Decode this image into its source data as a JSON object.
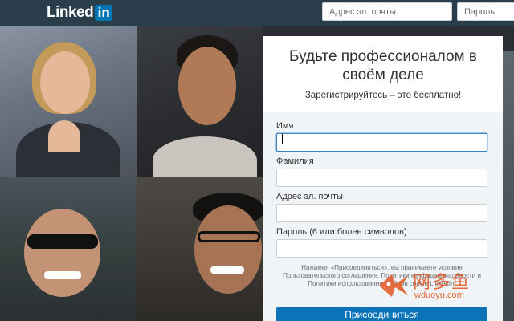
{
  "header": {
    "logo_text": "Linked",
    "logo_in": "in",
    "email_placeholder": "Адрес эл. почты",
    "password_placeholder": "Пароль"
  },
  "signup": {
    "title": "Будьте профессионалом в своём деле",
    "subtitle": "Зарегистрируйтесь – это бесплатно!",
    "first_name_label": "Имя",
    "last_name_label": "Фамилия",
    "email_label": "Адрес эл. почты",
    "password_label": "Пароль (6 или более символов)",
    "terms": "Нажимая «Присоединиться», вы принимаете условия Пользовательского соглашения, Политики конфиденциальности и Политики использования файлов cookie LinkedIn.",
    "join_button": "Присоединиться"
  },
  "watermark": {
    "cn_text": "网多鱼",
    "url": "wduoyu.com"
  },
  "colors": {
    "topbar": "#293e4a",
    "brand_blue": "#0077b5",
    "button_blue": "#0b74b8",
    "watermark": "#e15a29"
  }
}
